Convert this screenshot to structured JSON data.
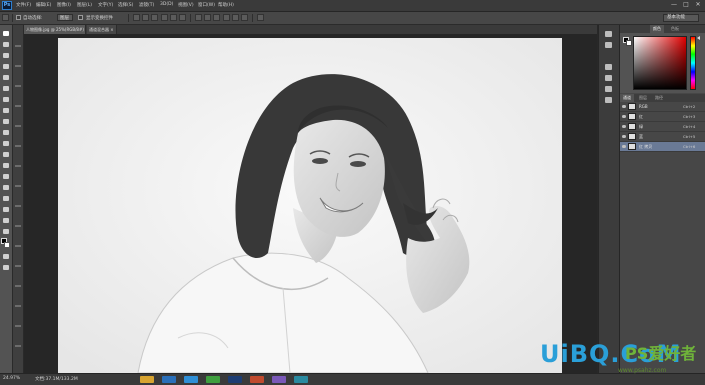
{
  "menubar": {
    "logo": "Ps",
    "items": [
      "文件(F)",
      "编辑(E)",
      "图像(I)",
      "图层(L)",
      "文字(Y)",
      "选择(S)",
      "滤镜(T)",
      "3D(D)",
      "视图(V)",
      "窗口(W)",
      "帮助(H)"
    ],
    "window_buttons": [
      "—",
      "□",
      "✕"
    ]
  },
  "options_bar": {
    "auto_select_label": "自动选择:",
    "auto_select_value": "图层",
    "show_transform_label": "显示变换控件",
    "workspace": "基本功能"
  },
  "doc_tabs": [
    "人物图像.jpg @ 25%(RGB/8#) ×",
    "通道混合器 ×"
  ],
  "status": {
    "zoom": "24.97%",
    "doc_info": "文档:37.1M/133.2M"
  },
  "color_panel": {
    "tabs": [
      "颜色",
      "色板"
    ]
  },
  "channels_panel": {
    "tabs": [
      "通道",
      "图层",
      "路径"
    ],
    "rows": [
      {
        "name": "RGB",
        "key": "Ctrl+2",
        "selected": false
      },
      {
        "name": "红",
        "key": "Ctrl+3",
        "selected": false
      },
      {
        "name": "绿",
        "key": "Ctrl+4",
        "selected": false
      },
      {
        "name": "蓝",
        "key": "Ctrl+5",
        "selected": false
      },
      {
        "name": "红 拷贝",
        "key": "Ctrl+6",
        "selected": true
      }
    ]
  },
  "watermark": {
    "text": "UiBQ.CoM",
    "logo": "PS爱好者",
    "site": "www.psahz.com"
  },
  "colors": {
    "foreground": "#000000",
    "background": "#ffffff",
    "selected_row": "#6a7a96"
  }
}
